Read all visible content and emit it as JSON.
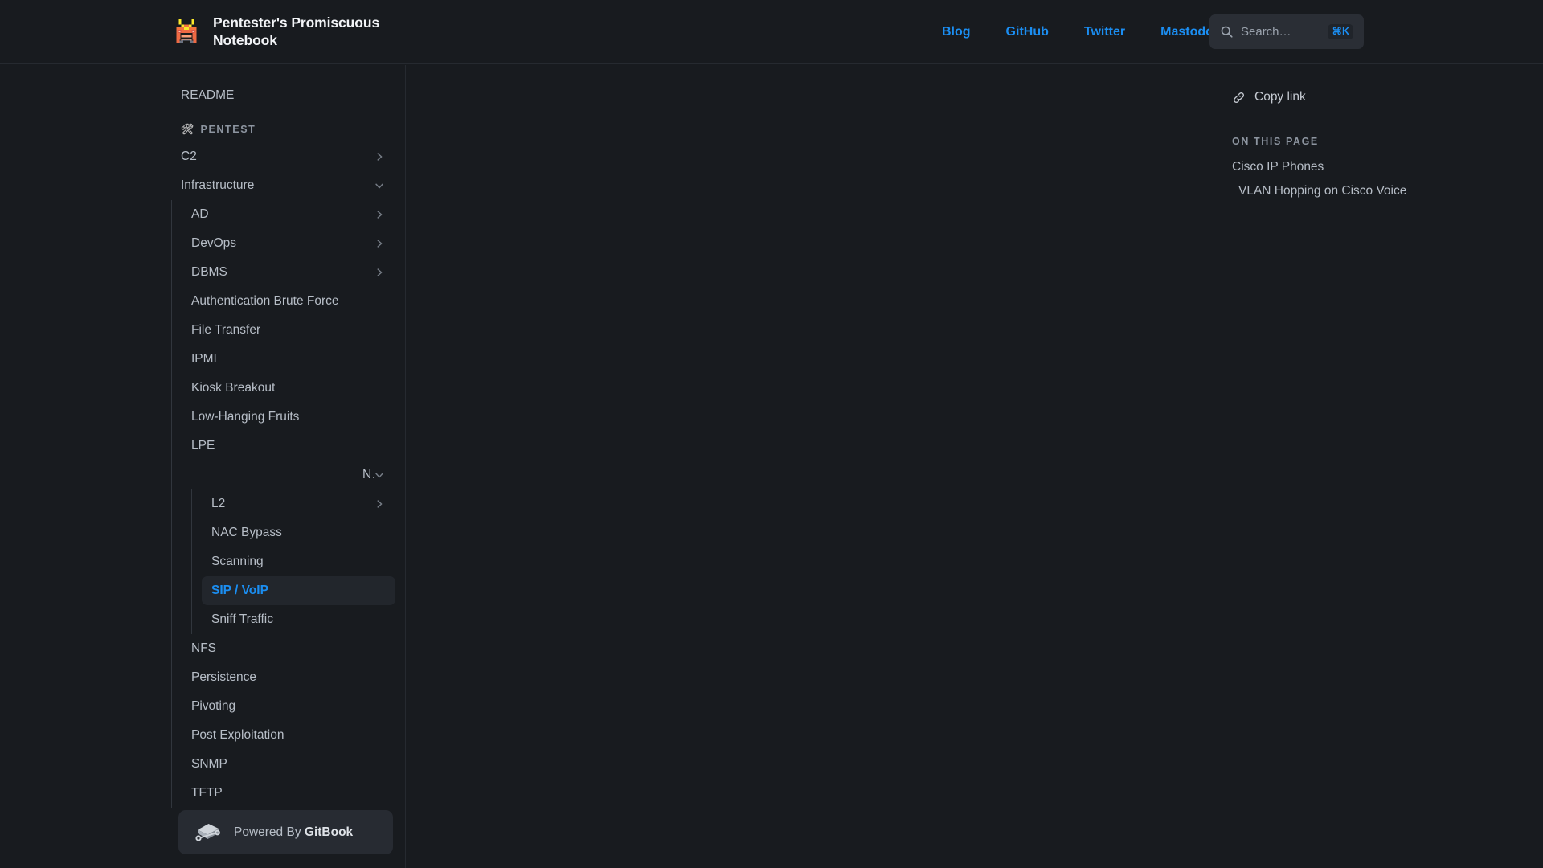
{
  "header": {
    "brand_title": "Pentester's Promiscuous Notebook",
    "logo_icon": "samurai-icon",
    "nav": [
      {
        "label": "Blog"
      },
      {
        "label": "GitHub"
      },
      {
        "label": "Twitter"
      },
      {
        "label": "Mastodon"
      }
    ],
    "search": {
      "placeholder": "Search…",
      "icon": "search-icon",
      "shortcut": "⌘K"
    },
    "accent_color": "#1b8ef2"
  },
  "sidebar": {
    "readme": {
      "label": "README"
    },
    "section": {
      "label": "Pentest",
      "emoji": "🛠"
    },
    "items": [
      {
        "label": "C2",
        "chevron": "right",
        "level": 1
      },
      {
        "label": "Infrastructure",
        "chevron": "down",
        "level": 1
      }
    ],
    "infrastructure_children": [
      {
        "label": "AD",
        "chevron": "right"
      },
      {
        "label": "DevOps",
        "chevron": "right"
      },
      {
        "label": "DBMS",
        "chevron": "right"
      },
      {
        "label": "Authentication Brute Force",
        "chevron": "none"
      },
      {
        "label": "File Transfer",
        "chevron": "none"
      },
      {
        "label": "IPMI",
        "chevron": "none"
      },
      {
        "label": "Kiosk Breakout",
        "chevron": "none"
      },
      {
        "label": "Low-Hanging Fruits",
        "chevron": "none"
      },
      {
        "label": "LPE",
        "chevron": "none"
      },
      {
        "label": "Networks",
        "chevron": "down"
      }
    ],
    "networks_children": [
      {
        "label": "L2",
        "chevron": "right",
        "active": false
      },
      {
        "label": "NAC Bypass",
        "chevron": "none",
        "active": false
      },
      {
        "label": "Scanning",
        "chevron": "none",
        "active": false
      },
      {
        "label": "SIP / VoIP",
        "chevron": "none",
        "active": true
      },
      {
        "label": "Sniff Traffic",
        "chevron": "none",
        "active": false
      }
    ],
    "infrastructure_children_after": [
      {
        "label": "NFS",
        "chevron": "none"
      },
      {
        "label": "Persistence",
        "chevron": "none"
      },
      {
        "label": "Pivoting",
        "chevron": "none"
      },
      {
        "label": "Post Exploitation",
        "chevron": "none"
      },
      {
        "label": "SNMP",
        "chevron": "none"
      },
      {
        "label": "TFTP",
        "chevron": "none"
      }
    ],
    "footer": {
      "prefix": "Powered By ",
      "brand": "GitBook",
      "icon": "gitbook-logo-icon"
    }
  },
  "rightbar": {
    "copy_link": {
      "label": "Copy link",
      "icon": "link-icon"
    },
    "on_this_page_label": "On this page",
    "toc": [
      {
        "label": "Cisco IP Phones",
        "sub": false
      },
      {
        "label": "VLAN Hopping on Cisco Voice",
        "sub": true
      }
    ]
  }
}
